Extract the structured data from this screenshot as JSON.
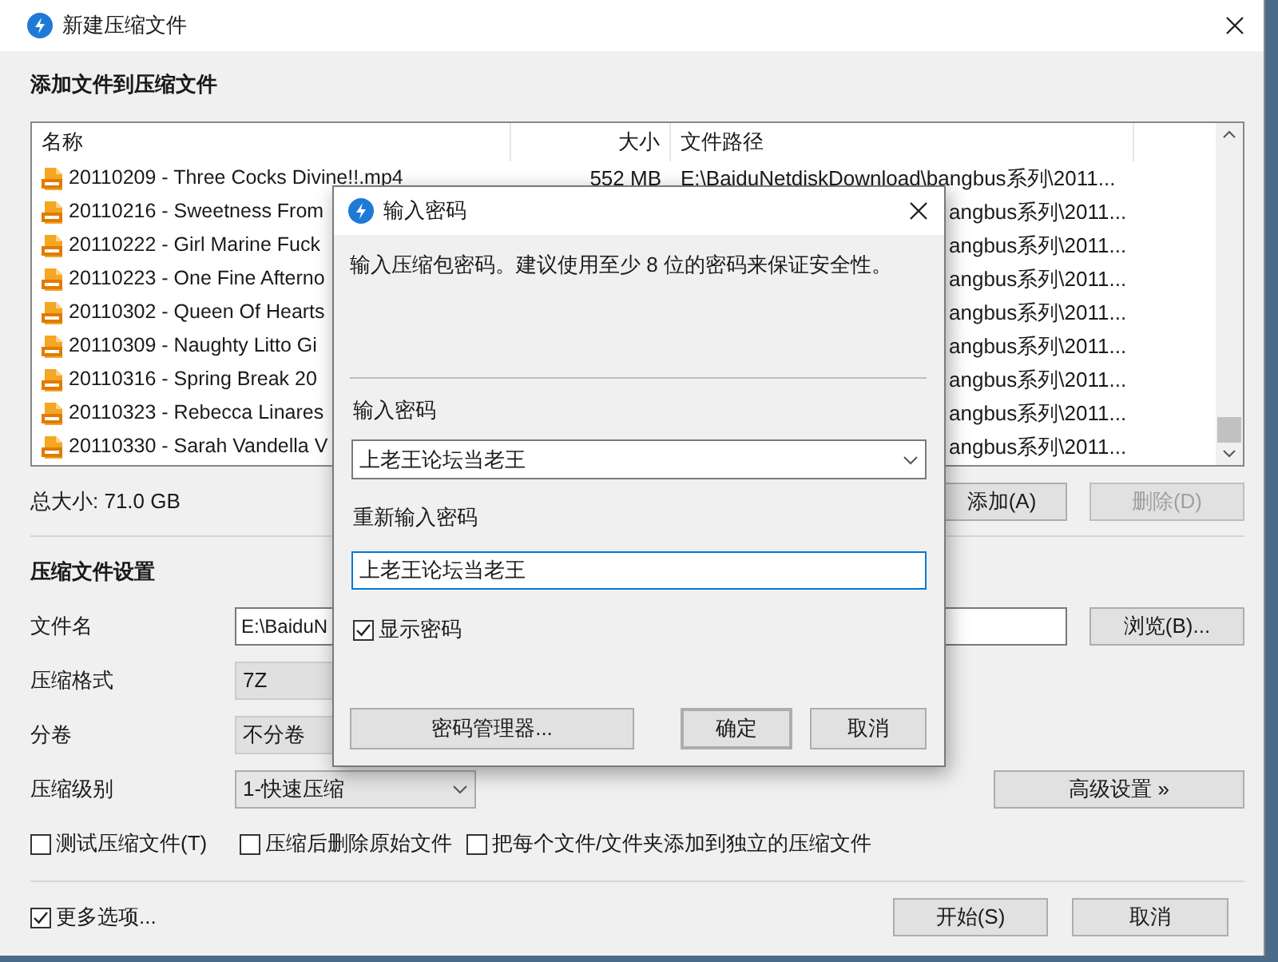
{
  "window": {
    "title": "新建压缩文件"
  },
  "files": {
    "heading": "添加文件到压缩文件",
    "columns": [
      {
        "label": "名称"
      },
      {
        "label": "大小"
      },
      {
        "label": "文件路径"
      }
    ],
    "rows": [
      {
        "name": "20110209 - Three Cocks Divine!!.mp4",
        "size": "552 MB",
        "path": "E:\\BaiduNetdiskDownload\\bangbus系列\\2011..."
      },
      {
        "name": "20110216 - Sweetness From",
        "path": "angbus系列\\2011..."
      },
      {
        "name": "20110222 - Girl Marine Fuck",
        "path": "angbus系列\\2011..."
      },
      {
        "name": "20110223 - One Fine Afterno",
        "path": "angbus系列\\2011..."
      },
      {
        "name": "20110302 - Queen Of Hearts",
        "path": "angbus系列\\2011..."
      },
      {
        "name": "20110309 - Naughty Litto Gi",
        "path": "angbus系列\\2011..."
      },
      {
        "name": "20110316 - Spring Break 20",
        "path": "angbus系列\\2011..."
      },
      {
        "name": "20110323 - Rebecca Linares",
        "path": "angbus系列\\2011..."
      },
      {
        "name": "20110330 - Sarah Vandella V",
        "path": "angbus系列\\2011..."
      }
    ],
    "total": "总大小: 71.0 GB",
    "buttons": [
      {
        "label": "添加(A)",
        "disabled": false
      },
      {
        "label": "删除(D)",
        "disabled": true
      }
    ]
  },
  "settings": {
    "heading": "压缩文件设置",
    "fields": [
      {
        "kind": "text",
        "label": "文件名",
        "value": "E:\\BaiduN",
        "button": "浏览(B)..."
      },
      {
        "kind": "combo",
        "label": "压缩格式",
        "value": "7Z",
        "disabled": true
      },
      {
        "kind": "combo",
        "label": "分卷",
        "value": "不分卷",
        "disabled": true
      },
      {
        "kind": "combo",
        "label": "压缩级别",
        "value": "1-快速压缩",
        "disabled": false,
        "button": "高级设置 »"
      }
    ],
    "checkboxes": [
      {
        "label": "测试压缩文件(T)",
        "checked": false
      },
      {
        "label": "压缩后删除原始文件",
        "checked": false
      },
      {
        "label": "把每个文件/文件夹添加到独立的压缩文件",
        "checked": false
      }
    ],
    "more_options": {
      "label": "更多选项...",
      "checked": true
    },
    "buttons": [
      {
        "label": "开始(S)"
      },
      {
        "label": "取消"
      }
    ]
  },
  "dialog": {
    "title": "输入密码",
    "description": "输入压缩包密码。建议使用至少 8 位的密码来保证安全性。",
    "password": {
      "label": "输入密码",
      "value": "上老王论坛当老王"
    },
    "confirm": {
      "label": "重新输入密码",
      "value": "上老王论坛当老王",
      "focused": true
    },
    "show_password": {
      "label": "显示密码",
      "checked": true
    },
    "buttons": [
      {
        "label": "密码管理器...",
        "default": false
      },
      {
        "label": "确定",
        "default": true
      },
      {
        "label": "取消",
        "default": false
      }
    ]
  }
}
